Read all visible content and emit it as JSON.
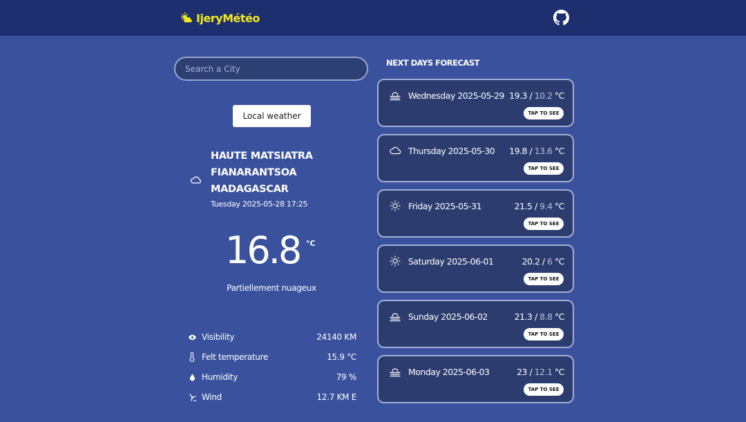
{
  "header": {
    "brand": "IjeryMétéo",
    "github_icon": "github-icon"
  },
  "search": {
    "placeholder": "Search a City",
    "value": ""
  },
  "local_button": "Local weather",
  "current": {
    "icon": "cloud-icon",
    "region": "HAUTE MATSIATRA",
    "city": "FIANARANTSOA",
    "country": "MADAGASCAR",
    "datetime": "Tuesday 2025-05-28 17:25",
    "temperature": "16.8",
    "unit": "°C",
    "condition": "Partiellement nuageux"
  },
  "stats": [
    {
      "icon": "eye-icon",
      "label": "Visibility",
      "value": "24140 KM"
    },
    {
      "icon": "thermometer-icon",
      "label": "Felt temperature",
      "value": "15.9 °C"
    },
    {
      "icon": "droplet-icon",
      "label": "Humidity",
      "value": "79 %"
    },
    {
      "icon": "wind-icon",
      "label": "Wind",
      "value": "12.7 KM E"
    }
  ],
  "forecast": {
    "title": "NEXT DAYS FORECAST",
    "tap_label": "TAP TO SEE",
    "unit": "°C",
    "days": [
      {
        "icon": "fog-icon",
        "day": "Wednesday 2025-05-29",
        "max": "19.3",
        "min": "10.2"
      },
      {
        "icon": "cloud-icon",
        "day": "Thursday 2025-05-30",
        "max": "19.8",
        "min": "13.6"
      },
      {
        "icon": "sun-icon",
        "day": "Friday 2025-05-31",
        "max": "21.5",
        "min": "9.4"
      },
      {
        "icon": "sun-icon",
        "day": "Saturday 2025-06-01",
        "max": "20.2",
        "min": "6"
      },
      {
        "icon": "fog-icon",
        "day": "Sunday 2025-06-02",
        "max": "21.3",
        "min": "8.8"
      },
      {
        "icon": "fog-icon",
        "day": "Monday 2025-06-03",
        "max": "23",
        "min": "12.1"
      }
    ]
  },
  "colors": {
    "background": "#3a529e",
    "topbar": "#1d2f6e",
    "brand": "#f3e91d",
    "card": "#2c3c6e"
  }
}
